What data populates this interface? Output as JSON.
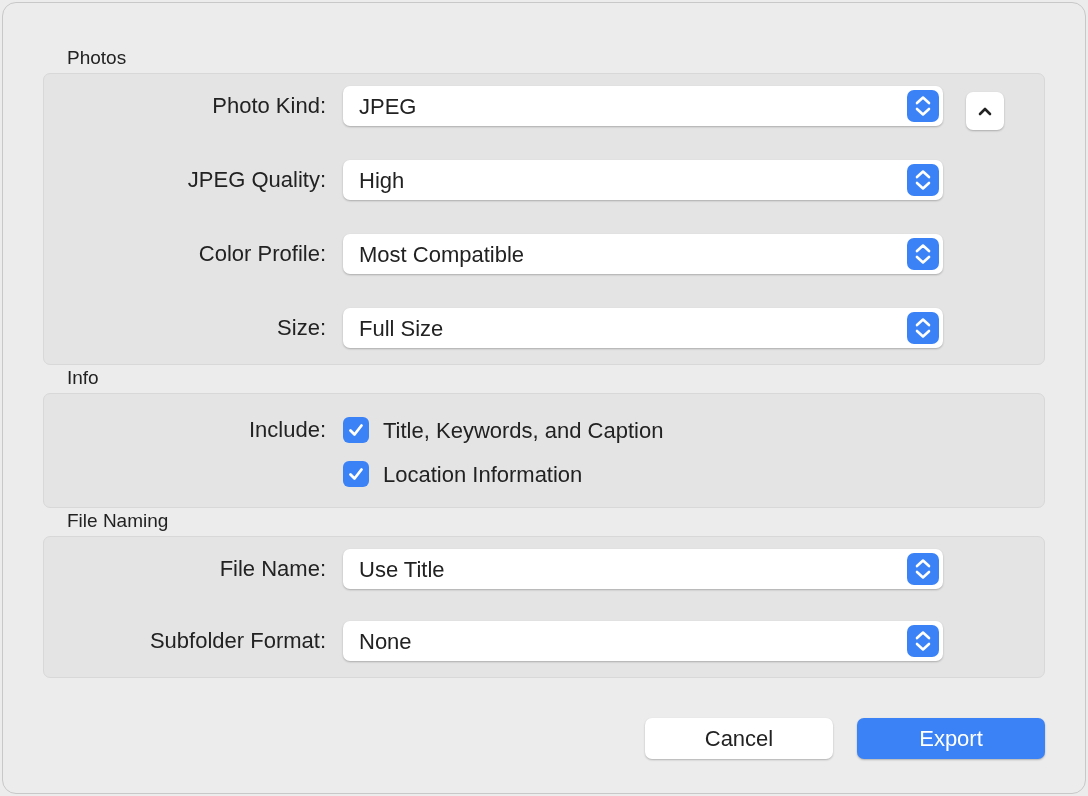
{
  "sections": [
    {
      "title": "Photos",
      "collapse_button": true,
      "rows": [
        {
          "kind": "popup",
          "label": "Photo Kind:",
          "value": "JPEG"
        },
        {
          "kind": "popup",
          "label": "JPEG Quality:",
          "value": "High"
        },
        {
          "kind": "popup",
          "label": "Color Profile:",
          "value": "Most Compatible"
        },
        {
          "kind": "popup",
          "label": "Size:",
          "value": "Full Size"
        }
      ]
    },
    {
      "title": "Info",
      "collapse_button": false,
      "rows": [
        {
          "kind": "checkboxes",
          "label": "Include:",
          "options": [
            {
              "label": "Title, Keywords, and Caption",
              "checked": true
            },
            {
              "label": "Location Information",
              "checked": true
            }
          ]
        }
      ]
    },
    {
      "title": "File Naming",
      "collapse_button": false,
      "rows": [
        {
          "kind": "popup",
          "label": "File Name:",
          "value": "Use Title"
        },
        {
          "kind": "popup",
          "label": "Subfolder Format:",
          "value": "None"
        }
      ]
    }
  ],
  "buttons": [
    {
      "label": "Cancel",
      "default": false
    },
    {
      "label": "Export",
      "default": true
    }
  ]
}
